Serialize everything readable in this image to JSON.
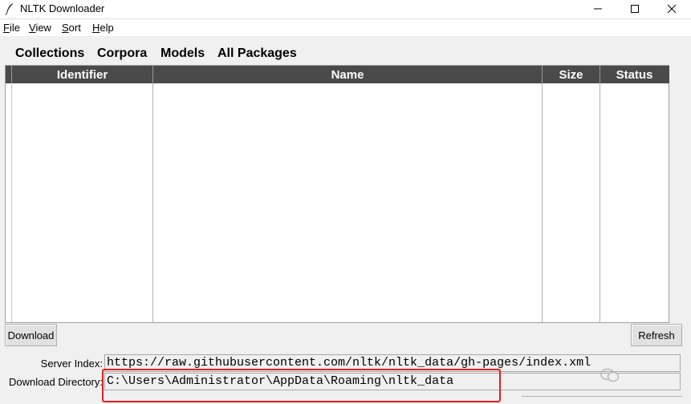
{
  "window": {
    "title": "NLTK Downloader"
  },
  "menu": [
    {
      "label": "File"
    },
    {
      "label": "View"
    },
    {
      "label": "Sort"
    },
    {
      "label": "Help"
    }
  ],
  "tabs": [
    {
      "label": "Collections"
    },
    {
      "label": "Corpora"
    },
    {
      "label": "Models"
    },
    {
      "label": "All Packages"
    }
  ],
  "table": {
    "columns": [
      "Identifier",
      "Name",
      "Size",
      "Status"
    ],
    "rows": []
  },
  "buttons": {
    "download": "Download",
    "refresh": "Refresh"
  },
  "info": {
    "server_label": "Server Index:",
    "server_value": "https://raw.githubusercontent.com/nltk/nltk_data/gh-pages/index.xml",
    "dir_label": "Download Directory:",
    "dir_value": "C:\\Users\\Administrator\\AppData\\Roaming\\nltk_data"
  },
  "colors": {
    "header_bg": "#4a4a4a",
    "highlight": "#e02020"
  }
}
